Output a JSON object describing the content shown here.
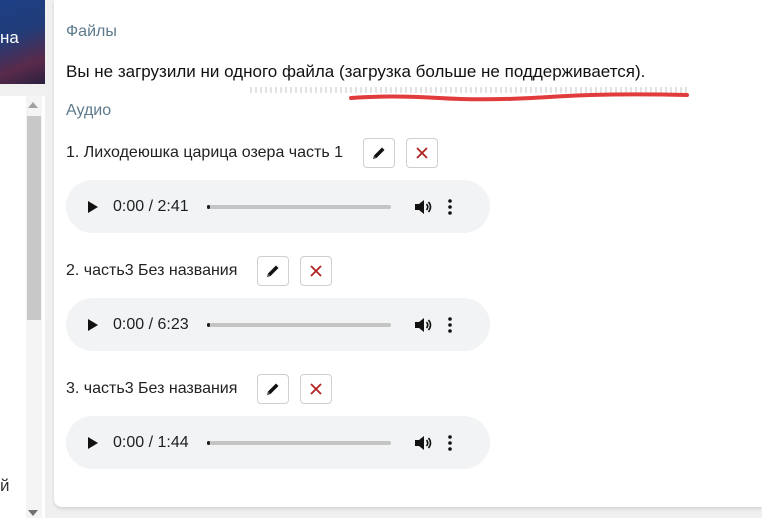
{
  "sidebar": {
    "banner_text": "на",
    "cut_text": "й"
  },
  "files": {
    "title": "Файлы",
    "notice": "Вы не загрузили ни одного файла (загрузка больше не поддерживается)."
  },
  "audio": {
    "title": "Аудио",
    "tracks": [
      {
        "label": "1. Лиходеюшка царица озера часть 1",
        "time": "0:00 / 2:41",
        "progress": 0
      },
      {
        "label": "2. часть3 Без названия",
        "time": "0:00 / 6:23",
        "progress": 0
      },
      {
        "label": "3. часть3 Без названия",
        "time": "0:00 / 1:44",
        "progress": 0
      }
    ]
  },
  "colors": {
    "section_title": "#5d7a8c",
    "delete_icon": "#b22222",
    "annotation": "#e23b3b",
    "player_bg": "#f1f3f4"
  },
  "icons": {
    "edit": "pencil-icon",
    "delete": "close-icon",
    "play": "play-icon",
    "volume": "volume-icon",
    "more": "more-vertical-icon"
  }
}
